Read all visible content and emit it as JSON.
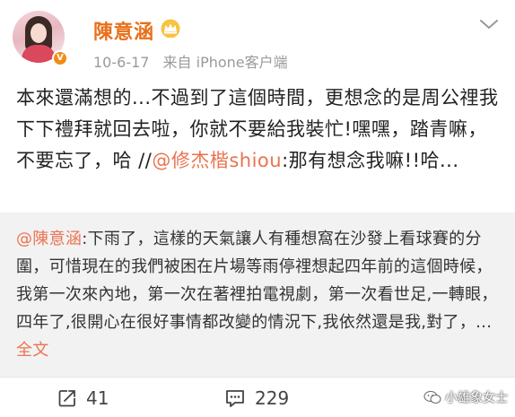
{
  "post": {
    "username": "陳意涵",
    "date": "10-6-17",
    "source": "来自 iPhone客户端",
    "text_before_mention": "本來還滿想的...不過到了這個時間，更想念的是周公𥚃我下下禮拜就回去啦，你就不要給我裝忙!嘿嘿，踏青嘛，不要忘了，哈 //",
    "mention": "@修杰楷shiou",
    "text_after_mention": ":那有想念我嘛!!哈..."
  },
  "repost": {
    "mention": "@陳意涵",
    "text": ":下雨了，這樣的天氣讓人有種想窩在沙發上看球賽的分圍，可惜現在的我們被困在片場等雨停𥚃想起四年前的這個時候，我第一次來內地，第一次在著裡拍電視劇，第一次看世足,一轉眼，四年了,很開心在很好事情都改變的情況下,我依然還是我,對了，...",
    "full_text_link": "全文"
  },
  "footer": {
    "repost_count": "41",
    "comment_count": "229",
    "watermark": "小雄象女士"
  },
  "icons": {
    "avatar": "avatar",
    "verified": "verified-badge-icon",
    "crown": "crown-icon",
    "more": "chevron-down-icon",
    "repost": "repost-icon",
    "comment": "comment-icon",
    "watermark": "wechat-icon"
  },
  "colors": {
    "accent": "#eb7350",
    "username": "#e8701b",
    "meta": "#9a9a9a",
    "repost_bg": "#f2f2f2"
  }
}
